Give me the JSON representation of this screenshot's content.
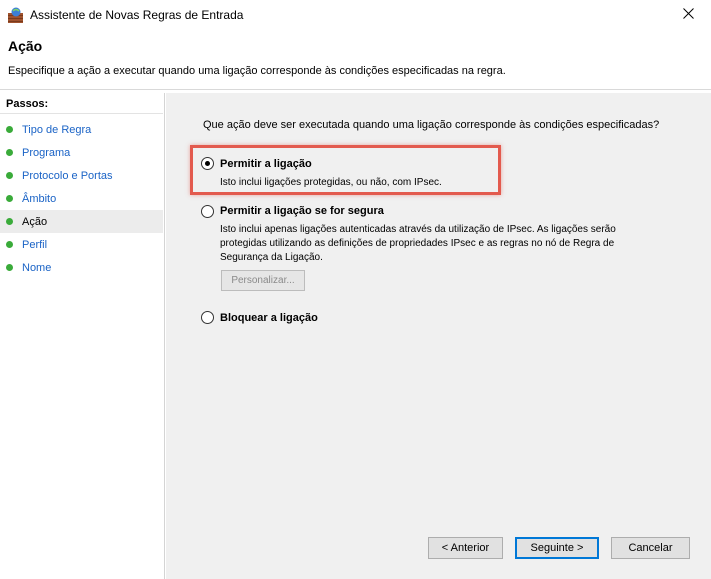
{
  "window": {
    "title": "Assistente de Novas Regras de Entrada",
    "icon": "firewall-icon",
    "close_icon": "close-icon"
  },
  "header": {
    "title": "Ação",
    "subtitle": "Especifique a ação a executar quando uma ligação corresponde às condições especificadas na regra."
  },
  "sidebar": {
    "title": "Passos:",
    "items": [
      {
        "label": "Tipo de Regra",
        "active": false
      },
      {
        "label": "Programa",
        "active": false
      },
      {
        "label": "Protocolo e Portas",
        "active": false
      },
      {
        "label": "Âmbito",
        "active": false
      },
      {
        "label": "Ação",
        "active": true
      },
      {
        "label": "Perfil",
        "active": false
      },
      {
        "label": "Nome",
        "active": false
      }
    ],
    "dot_color": "#3aab3a"
  },
  "main": {
    "question": "Que ação deve ser executada quando uma ligação corresponde às condições especificadas?",
    "options": [
      {
        "label": "Permitir a ligação",
        "desc_lines": [
          "Isto inclui ligações protegidas, ou não, com IPsec."
        ],
        "checked": true
      },
      {
        "label": "Permitir a ligação se for segura",
        "desc_lines": [
          "Isto inclui apenas ligações autenticadas através da utilização de IPsec. As ligações serão",
          "protegidas utilizando as definições de propriedades IPsec e as regras no nó de Regra de",
          "Segurança da Ligação."
        ],
        "checked": false
      },
      {
        "label": "Bloquear a ligação",
        "desc_lines": [],
        "checked": false
      }
    ],
    "customize_button": "Personalizar...",
    "highlight_color": "#e35a4e"
  },
  "footer": {
    "back": "< Anterior",
    "next": "Seguinte >",
    "cancel": "Cancelar"
  }
}
